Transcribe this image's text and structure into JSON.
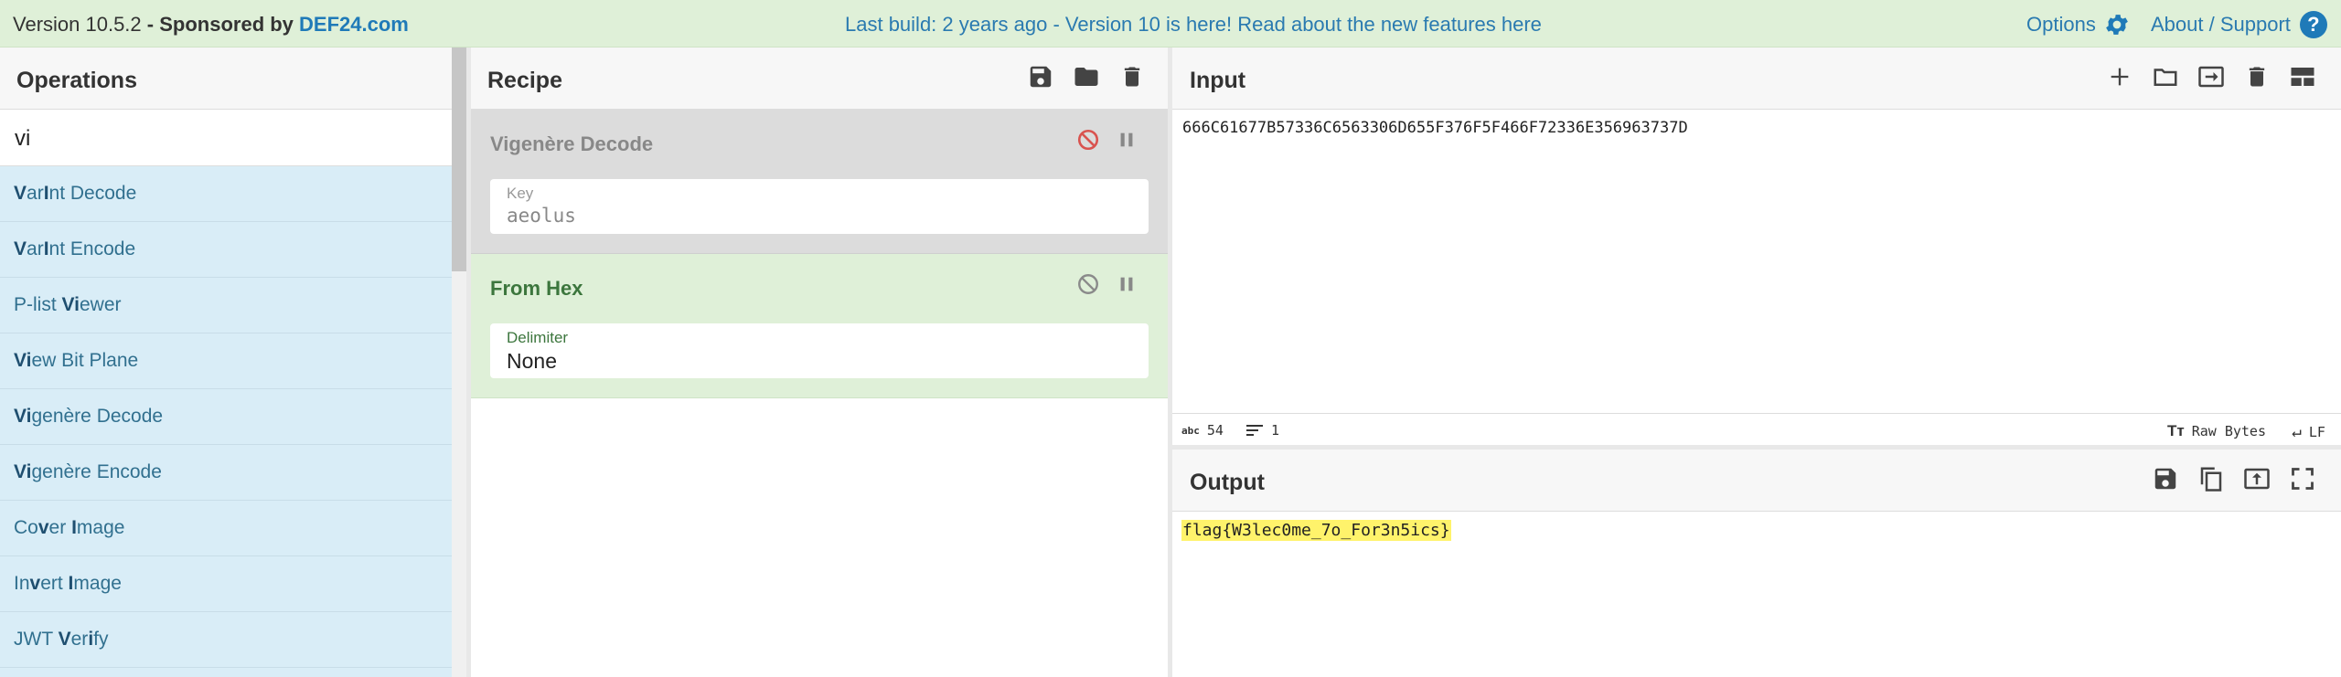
{
  "banner": {
    "version": "Version 10.5.2",
    "sponsored": "- Sponsored by",
    "sponsor_link": "DEF24.com",
    "notice": "Last build: 2 years ago - Version 10 is here! Read about the new features here",
    "options": "Options",
    "about": "About / Support",
    "help_glyph": "?"
  },
  "operations": {
    "title": "Operations",
    "search_value": "vi",
    "items": [
      {
        "pre": "",
        "b1": "V",
        "mid": "ar",
        "b2": "I",
        "post": "nt Decode"
      },
      {
        "pre": "",
        "b1": "V",
        "mid": "ar",
        "b2": "I",
        "post": "nt Encode"
      },
      {
        "pre": "P-list ",
        "b1": "Vi",
        "mid": "ewer",
        "b2": "",
        "post": ""
      },
      {
        "pre": "",
        "b1": "Vi",
        "mid": "ew Bit Plane",
        "b2": "",
        "post": ""
      },
      {
        "pre": "",
        "b1": "Vi",
        "mid": "genère Decode",
        "b2": "",
        "post": ""
      },
      {
        "pre": "",
        "b1": "Vi",
        "mid": "genère Encode",
        "b2": "",
        "post": ""
      },
      {
        "pre": "Co",
        "b1": "v",
        "mid": "er ",
        "b2": "I",
        "post": "mage"
      },
      {
        "pre": "In",
        "b1": "v",
        "mid": "ert ",
        "b2": "I",
        "post": "mage"
      },
      {
        "pre": "JWT ",
        "b1": "V",
        "mid": "er",
        "b2": "i",
        "post": "fy"
      }
    ]
  },
  "recipe": {
    "title": "Recipe",
    "ops": [
      {
        "name": "Vigenère Decode",
        "arg_label": "Key",
        "arg_value": "aeolus",
        "disabled": true
      },
      {
        "name": "From Hex",
        "arg_label": "Delimiter",
        "arg_value": "None",
        "disabled": false
      }
    ]
  },
  "input": {
    "title": "Input",
    "value": "666C61677B57336C6563306D655F376F5F466F72336E356963737D",
    "status": {
      "length_icon": "abc",
      "length": "54",
      "lines": "1",
      "encoding": "Raw Bytes",
      "eol": "LF"
    }
  },
  "output": {
    "title": "Output",
    "value": "flag{W3lec0me_7o_For3n5ics}"
  },
  "colors": {
    "banner_bg": "#dff0d8",
    "ops_list_bg": "#d9edf7",
    "link": "#1f7ab8",
    "disabled_op_bg": "#dcdcdc",
    "active_op_bg": "#dff0d8",
    "highlight": "#fff36b",
    "disable_icon_active": "#d9534f"
  }
}
